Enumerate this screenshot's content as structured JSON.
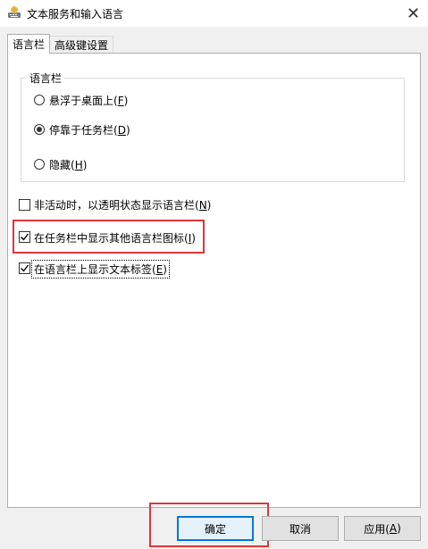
{
  "window": {
    "title": "文本服务和输入语言",
    "close": "✕"
  },
  "tabs": [
    "语言栏",
    "高级键设置"
  ],
  "group": {
    "title": "语言栏",
    "options": [
      {
        "label": "悬浮于桌面上(",
        "key": "F",
        "tail": ")",
        "checked": false
      },
      {
        "label": "停靠于任务栏(",
        "key": "D",
        "tail": ")",
        "checked": true
      },
      {
        "label": "隐藏(",
        "key": "H",
        "tail": ")",
        "checked": false
      }
    ]
  },
  "checkboxes": [
    {
      "label": "非活动时，以透明状态显示语言栏(",
      "key": "N",
      "tail": ")",
      "checked": false
    },
    {
      "label": "在任务栏中显示其他语言栏图标(",
      "key": "I",
      "tail": ")",
      "checked": true
    },
    {
      "label": "在语言栏上显示文本标签(",
      "key": "E",
      "tail": ")",
      "checked": true
    }
  ],
  "buttons": {
    "ok": "确定",
    "cancel": "取消",
    "apply_label": "应用(",
    "apply_key": "A",
    "apply_tail": ")"
  }
}
